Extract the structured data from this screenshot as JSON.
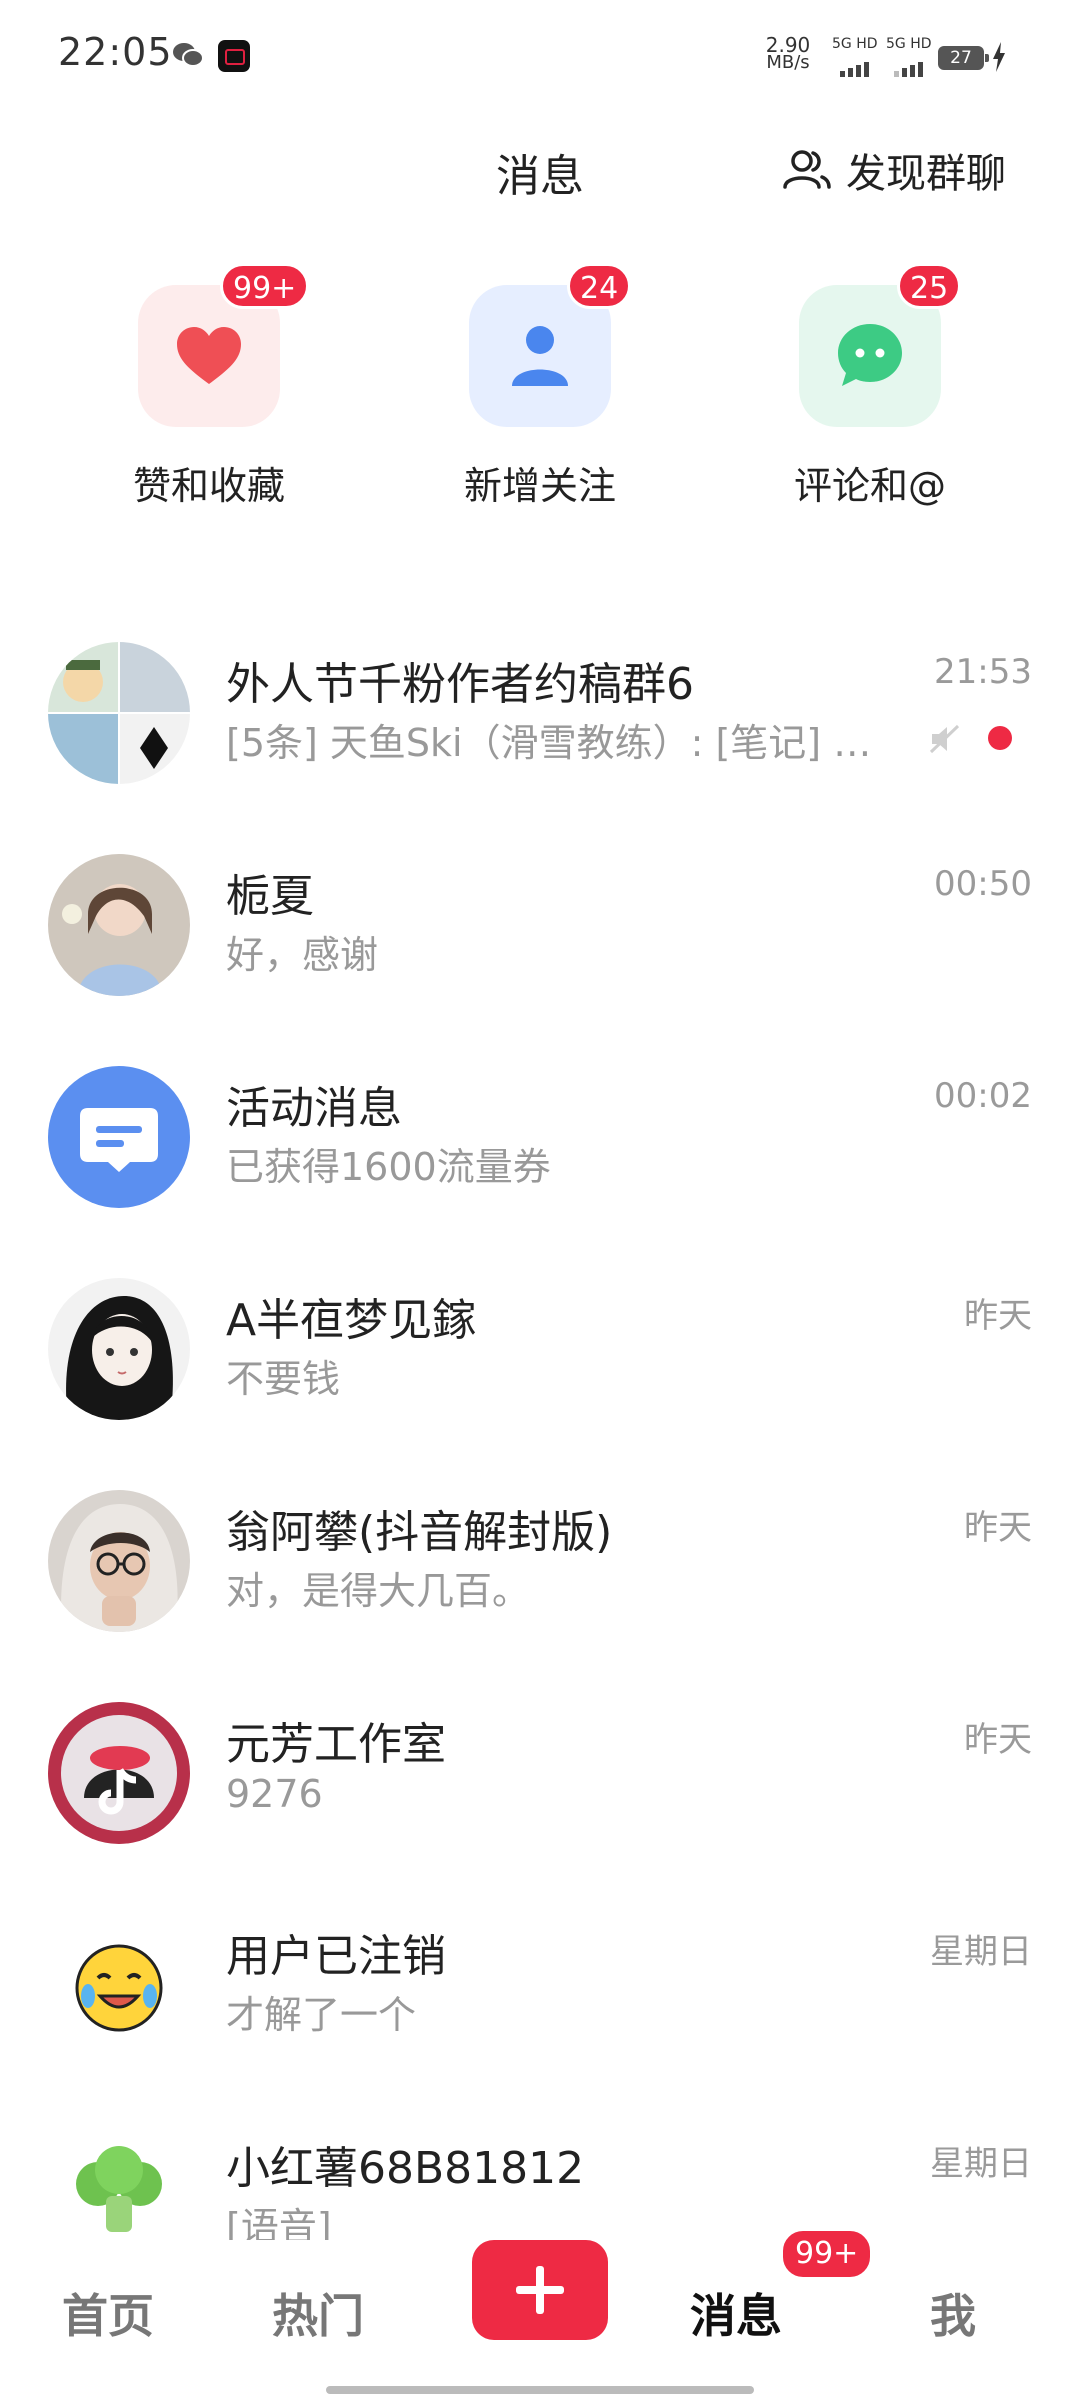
{
  "status_bar": {
    "time": "22:05",
    "net_speed": "2.90",
    "net_unit": "MB/s",
    "sim1": "5G HD",
    "sim2": "5G HD",
    "battery": "27"
  },
  "header": {
    "title": "消息",
    "discover_label": "发现群聊"
  },
  "quick_actions": [
    {
      "label": "赞和收藏",
      "badge": "99+",
      "icon": "heart-icon",
      "tile_color": "#fdecec",
      "icon_color": "#ef4f55"
    },
    {
      "label": "新增关注",
      "badge": "24",
      "icon": "person-icon",
      "tile_color": "#e6eeff",
      "icon_color": "#4a86ee"
    },
    {
      "label": "评论和@",
      "badge": "25",
      "icon": "chat-bubble-icon",
      "tile_color": "#e5f7ee",
      "icon_color": "#3dcb84"
    }
  ],
  "messages": [
    {
      "name": "外人节千粉作者约稿群6",
      "preview": "[5条] 天鱼Ski（滑雪教练）: [笔记] …",
      "time": "21:53",
      "muted": true,
      "unread_dot": true
    },
    {
      "name": "栀夏",
      "preview": "好，感谢",
      "time": "00:50"
    },
    {
      "name": "活动消息",
      "preview": "已获得1600流量券",
      "time": "00:02"
    },
    {
      "name": "A半亱梦见鎵",
      "preview": "不要钱",
      "time": "昨天"
    },
    {
      "name": "翁阿攀(抖音解封版)",
      "preview": "对，是得大几百。",
      "time": "昨天"
    },
    {
      "name": "元芳工作室",
      "preview": "9276",
      "time": "昨天"
    },
    {
      "name": "用户已注销",
      "preview": "才解了一个",
      "time": "星期日"
    },
    {
      "name": "小红薯68B81812",
      "preview": "[语音]",
      "time": "星期日"
    }
  ],
  "bottom_nav": {
    "home": "首页",
    "hot": "热门",
    "messages": "消息",
    "messages_badge": "99+",
    "me": "我"
  },
  "colors": {
    "accent": "#ee2a44",
    "muted_text": "#999999"
  }
}
